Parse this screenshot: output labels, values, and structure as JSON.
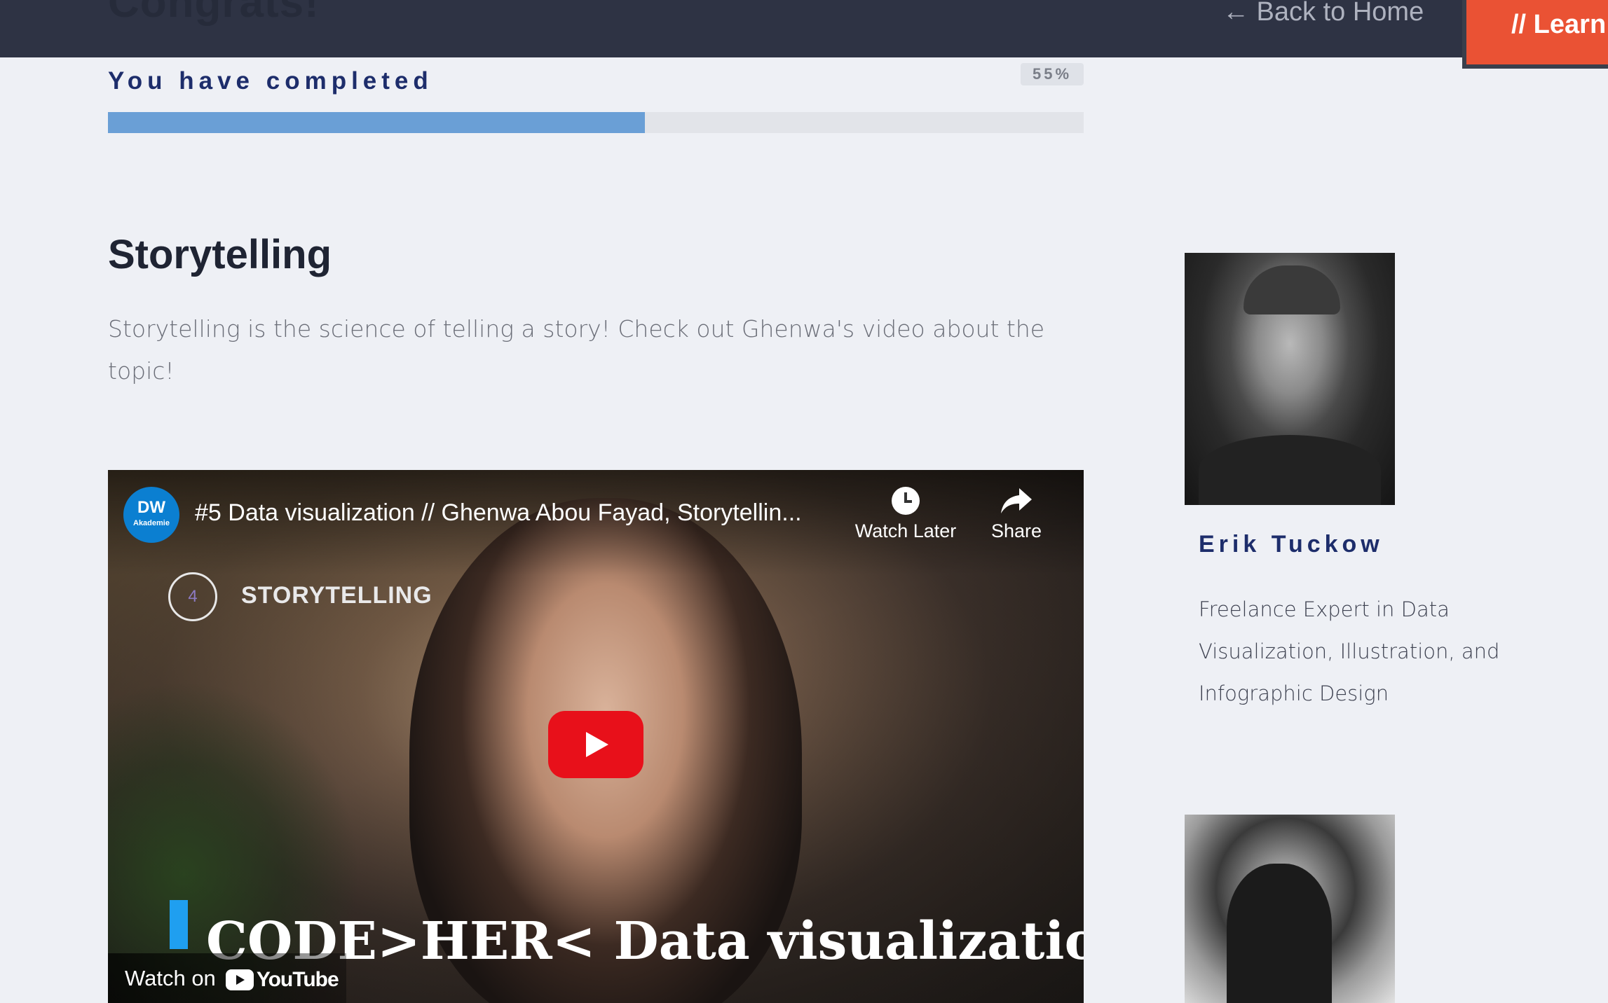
{
  "header": {
    "congrats": "Congrats!",
    "back_link": "← Back to Home",
    "learn_button": "// Learn"
  },
  "progress": {
    "label": "You have completed",
    "percent_text": "55%",
    "value": 0.55,
    "fill_color": "#6a9fd6"
  },
  "section": {
    "title": "Storytelling",
    "description": "Storytelling is the science of telling a story! Check out Ghenwa's video about the topic!"
  },
  "video": {
    "channel_logo": "DW",
    "channel_sub": "Akademie",
    "title": "#5 Data visualization // Ghenwa Abou Fayad, Storytellin...",
    "watch_later_label": "Watch Later",
    "share_label": "Share",
    "badge_number": "4",
    "overlay_label": "STORYTELLING",
    "caption": "CODE>HER< Data visualization",
    "watch_on_label": "Watch on",
    "youtube_word": "YouTube",
    "icons": {
      "watch_later": "clock-icon",
      "share": "share-arrow-icon",
      "play": "play-icon"
    },
    "play_color": "#e8101a"
  },
  "experts": [
    {
      "name": "Erik Tuckow",
      "description": "Freelance Expert in Data Visualization, Illustration, and Infographic Design"
    }
  ],
  "colors": {
    "header_bg": "#2e3344",
    "accent_orange": "#ea5234",
    "navy_text": "#1d2d6b",
    "page_bg": "#eef0f5"
  }
}
